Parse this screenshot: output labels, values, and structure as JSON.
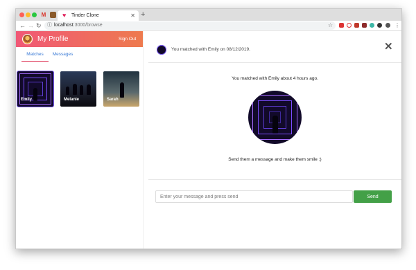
{
  "browser": {
    "tab_title": "Tinder Clone",
    "tab_icon": "heart-icon",
    "url_host": "localhost",
    "url_path": ":3000/browse"
  },
  "sidebar": {
    "title": "My Profile",
    "sign_out": "Sign Out",
    "tabs": [
      {
        "label": "Matches",
        "active": true
      },
      {
        "label": "Messages",
        "active": false
      }
    ],
    "matches": [
      {
        "name": "Emily"
      },
      {
        "name": "Melanie"
      },
      {
        "name": "Sarah"
      }
    ]
  },
  "main": {
    "header_text": "You matched with Emily on 08/12/2019.",
    "time_text": "You matched with Emily about 4 hours ago.",
    "cta_text": "Send them a message and make them smile :)",
    "input_placeholder": "Enter your message and press send",
    "input_value": "",
    "send_label": "Send"
  },
  "colors": {
    "header_gradient_start": "#f05876",
    "header_gradient_end": "#ee7a4e",
    "tab_link": "#3b7bd6",
    "active_tab_underline": "#e24a67",
    "send_button": "#43a047"
  }
}
